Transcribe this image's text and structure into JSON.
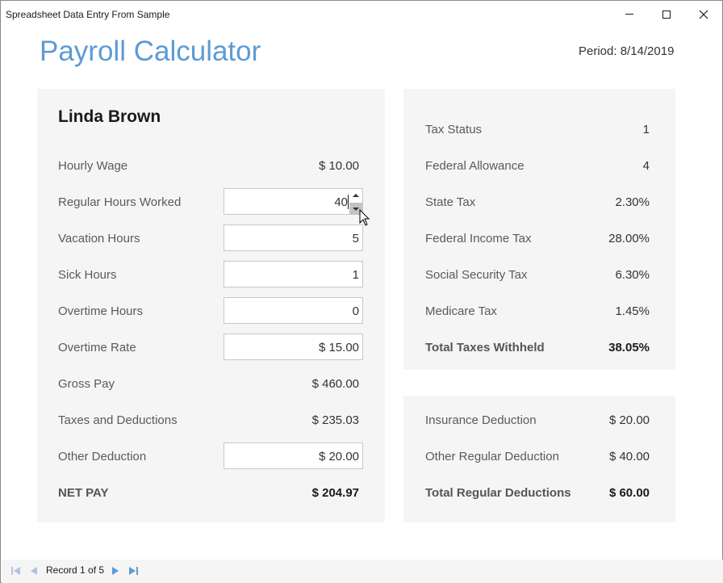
{
  "window": {
    "title": "Spreadsheet Data Entry From Sample"
  },
  "header": {
    "app_title": "Payroll Calculator",
    "period": "Period: 8/14/2019"
  },
  "employee": {
    "name": "Linda Brown",
    "rows": [
      {
        "label": "Hourly Wage",
        "value": "$ 10.00"
      },
      {
        "label": "Regular Hours Worked",
        "value": "40"
      },
      {
        "label": "Vacation Hours",
        "value": "5"
      },
      {
        "label": "Sick Hours",
        "value": "1"
      },
      {
        "label": "Overtime Hours",
        "value": "0"
      },
      {
        "label": "Overtime Rate",
        "value": "$ 15.00"
      },
      {
        "label": "Gross Pay",
        "value": "$ 460.00"
      },
      {
        "label": "Taxes and Deductions",
        "value": "$ 235.03"
      },
      {
        "label": "Other Deduction",
        "value": "$ 20.00"
      },
      {
        "label": "NET PAY",
        "value": "$ 204.97"
      }
    ]
  },
  "taxes": {
    "rows": [
      {
        "label": "Tax Status",
        "value": "1"
      },
      {
        "label": "Federal Allowance",
        "value": "4"
      },
      {
        "label": "State Tax",
        "value": "2.30%"
      },
      {
        "label": "Federal Income Tax",
        "value": "28.00%"
      },
      {
        "label": "Social Security Tax",
        "value": "6.30%"
      },
      {
        "label": "Medicare Tax",
        "value": "1.45%"
      },
      {
        "label": "Total Taxes Withheld",
        "value": "38.05%"
      }
    ]
  },
  "deductions": {
    "rows": [
      {
        "label": "Insurance Deduction",
        "value": "$ 20.00"
      },
      {
        "label": "Other Regular Deduction",
        "value": "$ 40.00"
      },
      {
        "label": "Total Regular Deductions",
        "value": "$ 60.00"
      }
    ]
  },
  "navigator": {
    "record_text": "Record 1 of 5"
  },
  "colors": {
    "accent": "#5b9bd5",
    "panel_bg": "#f5f5f5",
    "nav_icon": "#5b9bd5",
    "nav_icon_disabled": "#b0c4de"
  }
}
